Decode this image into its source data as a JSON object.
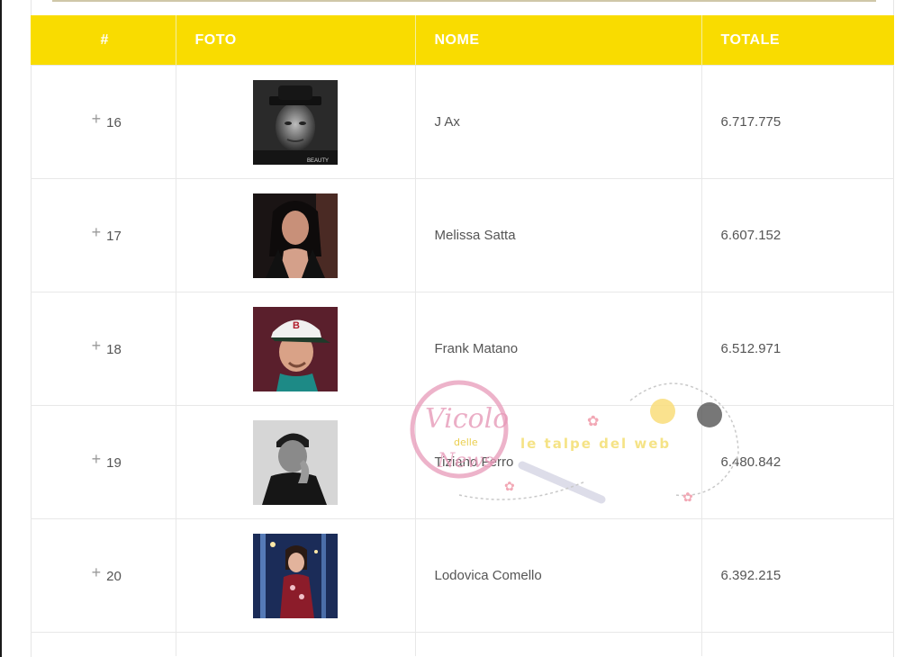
{
  "table": {
    "headers": [
      "#",
      "FOTO",
      "NOME",
      "TOTALE"
    ],
    "rows": [
      {
        "rank": "16",
        "name": "J Ax",
        "total": "6.717.775",
        "photo": "portrait-man-hat-bw",
        "badge": "BEAUTY"
      },
      {
        "rank": "17",
        "name": "Melissa Satta",
        "total": "6.607.152",
        "photo": "portrait-woman-dark-hair"
      },
      {
        "rank": "18",
        "name": "Frank Matano",
        "total": "6.512.971",
        "photo": "portrait-man-cap"
      },
      {
        "rank": "19",
        "name": "Tiziano Ferro",
        "total": "6.480.842",
        "photo": "portrait-man-bw"
      },
      {
        "rank": "20",
        "name": "Lodovica Comello",
        "total": "6.392.215",
        "photo": "portrait-woman-stage"
      }
    ]
  },
  "watermark": {
    "line1": "Vicolo",
    "line2": "delle",
    "line3": "News",
    "tagline": "le talpe del web"
  },
  "colors": {
    "header_bg": "#f9dc00",
    "header_text": "#ffffff",
    "watermark_pink": "#e79ab8"
  }
}
